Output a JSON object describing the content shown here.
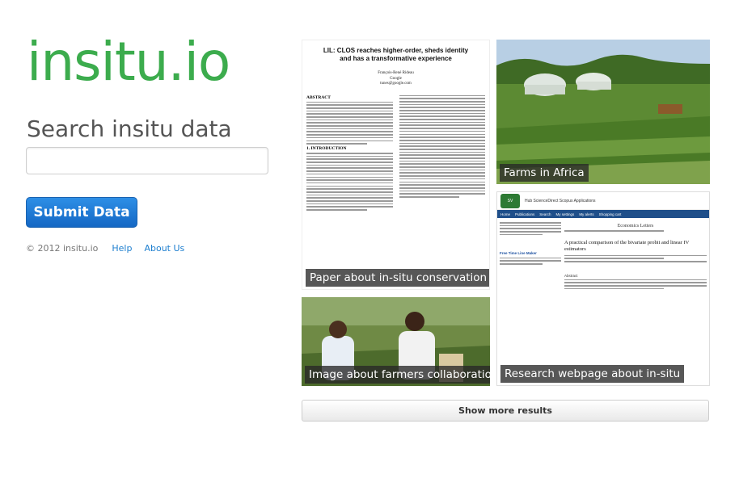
{
  "site": {
    "logo": "insitu.io",
    "search_title": "Search insitu data",
    "search_input": {
      "value": "",
      "placeholder": ""
    },
    "submit_label": "Submit Data"
  },
  "footer": {
    "copyright": "© 2012 insitu.io",
    "links": [
      "Help",
      "About Us"
    ]
  },
  "results": [
    {
      "caption": "Paper about in-situ conservation",
      "kind": "paper"
    },
    {
      "caption": "Farms in Africa",
      "kind": "photo"
    },
    {
      "caption": "Image about farmers collaboration",
      "kind": "photo"
    },
    {
      "caption": "Research webpage about in-situ",
      "kind": "webpage"
    }
  ],
  "paper": {
    "title_line1": "LIL: CLOS reaches higher-order, sheds identity",
    "title_line2": "and has a transformative experience",
    "author_name": "François-René Rideau",
    "author_org": "Google",
    "author_email": "tunes@google.com",
    "abstract_head": "ABSTRACT",
    "intro_head": "1. INTRODUCTION"
  },
  "webpage": {
    "nav": "Hub  ScienceDirect  Scopus  Applications",
    "bar_items": [
      "Home",
      "Publications",
      "Search",
      "My settings",
      "My alerts",
      "Shopping cart"
    ],
    "journal": "Economics Letters",
    "article_title": "A practical comparison of the bivariate probit and linear IV estimators",
    "sidebar_link": "Free Time Line Maker",
    "abstract_head": "Abstract"
  },
  "show_more_label": "Show more results",
  "colors": {
    "logo": "#3cac4d",
    "submit": "#1f7ad6",
    "link": "#1e7fcf"
  }
}
